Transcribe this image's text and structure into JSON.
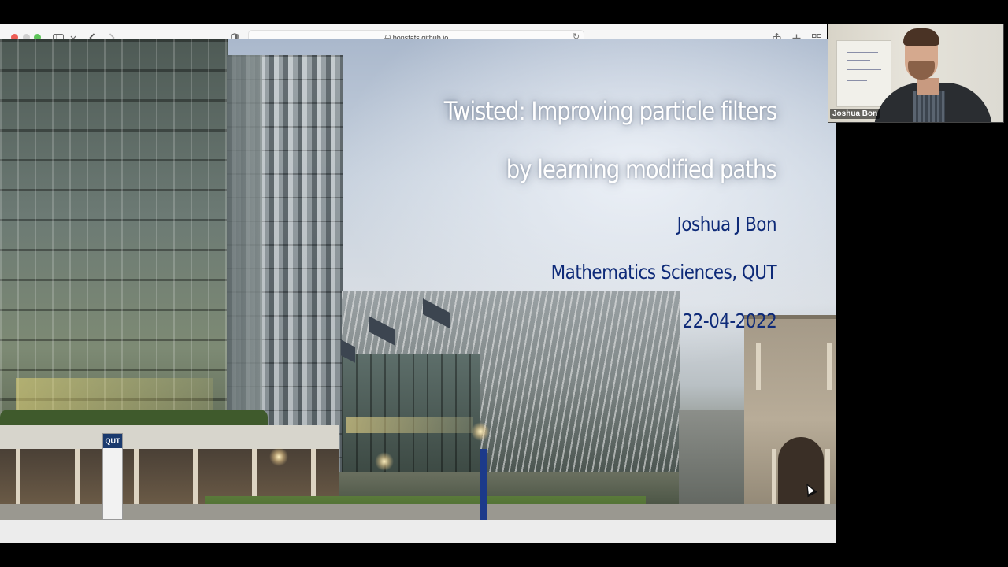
{
  "browser": {
    "url": "bonstats.github.io",
    "icons": [
      "sidebar-icon",
      "chevron-down-icon",
      "back-icon",
      "forward-icon",
      "privacy-shield-icon",
      "lock-icon",
      "reload-icon",
      "share-icon",
      "new-tab-icon",
      "tab-overview-icon"
    ]
  },
  "slide": {
    "title_line1": "Twisted: Improving particle filters",
    "title_line2": "by learning modified paths",
    "author": "Joshua J Bon",
    "affiliation": "Mathematics Sciences, QUT",
    "date": "22-04-2022",
    "sign_text": "QUT",
    "colors": {
      "title": "#ffffff",
      "meta": "#0e2a78"
    }
  },
  "webcam": {
    "name": "Joshua Bon"
  }
}
